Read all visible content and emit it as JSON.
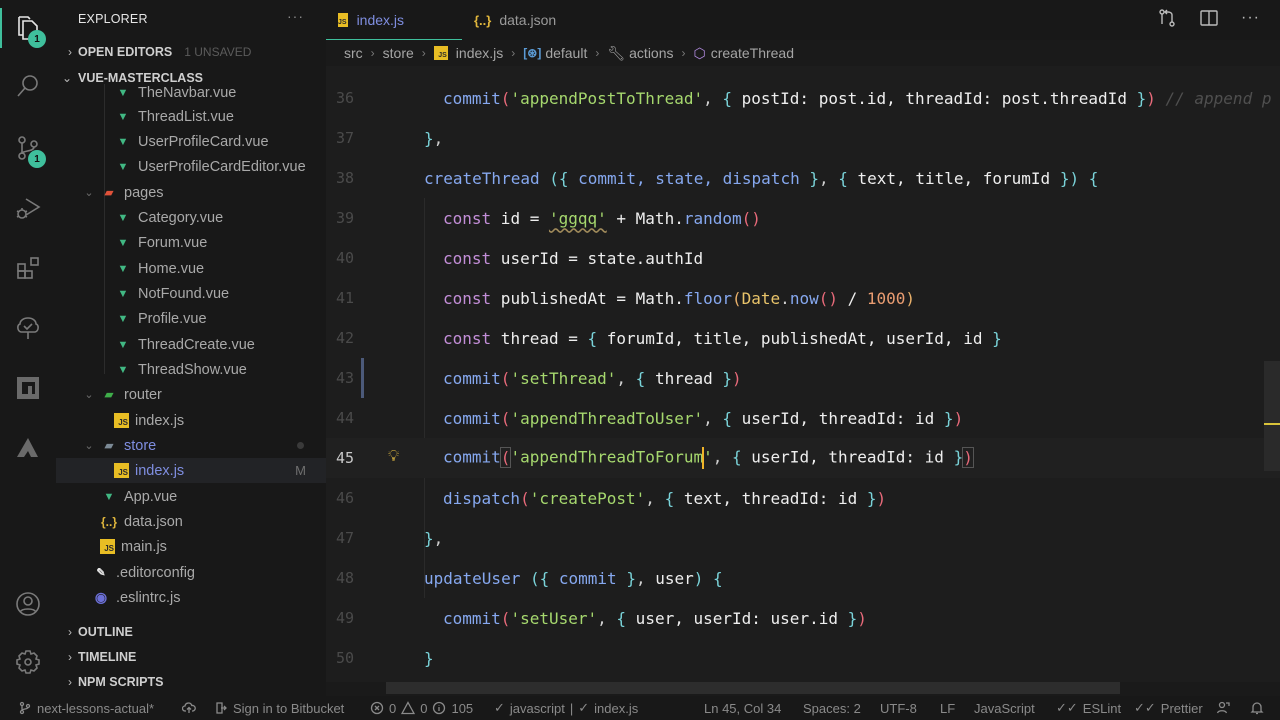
{
  "activity_bar": {
    "items": [
      {
        "icon": "files-icon",
        "badge": "1",
        "active": true
      },
      {
        "icon": "search-icon"
      },
      {
        "icon": "source-control-icon",
        "badge": "1"
      },
      {
        "icon": "run-debug-icon"
      },
      {
        "icon": "extensions-icon"
      },
      {
        "icon": "gitlens-tree-icon"
      },
      {
        "icon": "npm-icon"
      },
      {
        "icon": "atlassian-icon"
      }
    ],
    "bottom": [
      {
        "icon": "account-icon"
      },
      {
        "icon": "settings-gear-icon"
      }
    ]
  },
  "sidebar": {
    "title": "EXPLORER",
    "more": "···",
    "open_editors": {
      "label": "OPEN EDITORS",
      "sub": "1 UNSAVED"
    },
    "project": {
      "label": "VUE-MASTERCLASS"
    },
    "tree": [
      {
        "label": "TheNavbar.vue",
        "type": "vue",
        "depth": 3
      },
      {
        "label": "ThreadList.vue",
        "type": "vue",
        "depth": 3
      },
      {
        "label": "UserProfileCard.vue",
        "type": "vue",
        "depth": 3
      },
      {
        "label": "UserProfileCardEditor.vue",
        "type": "vue",
        "depth": 3
      },
      {
        "label": "pages",
        "type": "folder-pages",
        "depth": 2,
        "expanded": true
      },
      {
        "label": "Category.vue",
        "type": "vue",
        "depth": 3
      },
      {
        "label": "Forum.vue",
        "type": "vue",
        "depth": 3
      },
      {
        "label": "Home.vue",
        "type": "vue",
        "depth": 3
      },
      {
        "label": "NotFound.vue",
        "type": "vue",
        "depth": 3
      },
      {
        "label": "Profile.vue",
        "type": "vue",
        "depth": 3
      },
      {
        "label": "ThreadCreate.vue",
        "type": "vue",
        "depth": 3
      },
      {
        "label": "ThreadShow.vue",
        "type": "vue",
        "depth": 3
      },
      {
        "label": "router",
        "type": "folder-router",
        "depth": 2,
        "expanded": true
      },
      {
        "label": "index.js",
        "type": "js",
        "depth": 3
      },
      {
        "label": "store",
        "type": "folder",
        "depth": 2,
        "expanded": true,
        "modified": true
      },
      {
        "label": "index.js",
        "type": "js",
        "depth": 3,
        "selected": true,
        "status": "M"
      },
      {
        "label": "App.vue",
        "type": "vue",
        "depth": 2
      },
      {
        "label": "data.json",
        "type": "json",
        "depth": 2
      },
      {
        "label": "main.js",
        "type": "js",
        "depth": 2
      },
      {
        "label": ".editorconfig",
        "type": "editorconfig",
        "depth": 1
      },
      {
        "label": ".eslintrc.js",
        "type": "eslint",
        "depth": 1
      }
    ],
    "panels": [
      {
        "label": "OUTLINE"
      },
      {
        "label": "TIMELINE"
      },
      {
        "label": "NPM SCRIPTS"
      }
    ]
  },
  "tabs": [
    {
      "label": "index.js",
      "active": true,
      "dirty": true
    },
    {
      "label": "data.json",
      "active": false
    }
  ],
  "breadcrumb": {
    "items": [
      "src",
      "store",
      "index.js",
      "default",
      "actions",
      "createThread"
    ]
  },
  "editor": {
    "current_line": 45,
    "lines": [
      {
        "n": "36"
      },
      {
        "n": "37"
      },
      {
        "n": "38"
      },
      {
        "n": "39"
      },
      {
        "n": "40"
      },
      {
        "n": "41"
      },
      {
        "n": "42"
      },
      {
        "n": "43"
      },
      {
        "n": "44"
      },
      {
        "n": "45"
      },
      {
        "n": "46"
      },
      {
        "n": "47"
      },
      {
        "n": "48"
      },
      {
        "n": "49"
      },
      {
        "n": "50"
      }
    ],
    "tokens": {
      "commit": "commit",
      "dispatch": "dispatch",
      "const": "const",
      "appendPostToThread": "'appendPostToThread'",
      "postId_post_id": " postId: post.id, threadId: post.threadId ",
      "comment": "// append p",
      "createThread": "createThread",
      "createThread_params": " commit, state, dispatch ",
      "createThread_params2": " text, title, forumId ",
      "id": " id = ",
      "ggqq": "'ggqq'",
      "plus_math": " + Math.",
      "random": "random",
      "userId_decl": " userId = state.authId",
      "publishedAt_decl": " publishedAt = Math.",
      "floor": "floor",
      "Date": "Date",
      "now": "now",
      "div1000": " / ",
      "n1000": "1000",
      "thread_decl": " thread = ",
      "thread_obj": " forumId, title, publishedAt, userId, id ",
      "setThread": "'setThread'",
      "thread_arg": " thread ",
      "appendThreadToUser": "'appendThreadToUser'",
      "userId_threadId": " userId, threadId: id ",
      "appendThreadToForum": "'appendThreadToForum",
      "quote": "'",
      "createPost": "'createPost'",
      "text_threadId": " text, threadId: id ",
      "updateUser": "updateUser",
      "commit_only": " commit ",
      "user_arg": " user",
      "setUser": "'setUser'",
      "user_obj": " user, userId: user.id "
    }
  },
  "status_bar": {
    "branch": "next-lessons-actual*",
    "sign_in": "Sign in to Bitbucket",
    "errors": "0",
    "warnings": "0",
    "info": "105",
    "lint_js": "javascript",
    "lint_file": "index.js",
    "position": "Ln 45, Col 34",
    "spaces": "Spaces: 2",
    "encoding": "UTF-8",
    "eol": "LF",
    "language": "JavaScript",
    "eslint": "ESLint",
    "prettier": "Prettier"
  }
}
